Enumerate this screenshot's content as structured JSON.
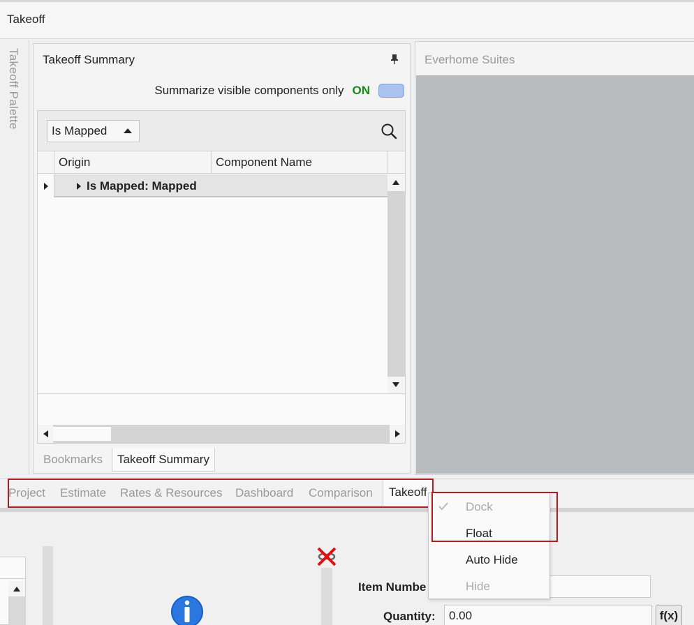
{
  "window": {
    "title": "Takeoff"
  },
  "palette": {
    "label": "Takeoff Palette"
  },
  "summary_panel": {
    "title": "Takeoff Summary",
    "summarize_label": "Summarize visible components only",
    "toggle_state": "ON",
    "filter_value": "Is Mapped",
    "columns": [
      "Origin",
      "Component Name"
    ],
    "group_row_label": "Is Mapped: Mapped",
    "tabs": [
      "Bookmarks",
      "Takeoff Summary"
    ],
    "active_tab": "Takeoff Summary"
  },
  "document": {
    "title": "Everhome Suites"
  },
  "bottom_tabs": {
    "items": [
      "Project",
      "Estimate",
      "Rates & Resources",
      "Dashboard",
      "Comparison",
      "Takeoff"
    ],
    "active": "Takeoff"
  },
  "context_menu": {
    "items": [
      {
        "label": "Dock",
        "checked": true,
        "disabled": true
      },
      {
        "label": "Float",
        "checked": false,
        "disabled": false
      },
      {
        "label": "Auto Hide",
        "checked": false,
        "disabled": false
      },
      {
        "label": "Hide",
        "checked": false,
        "disabled": true
      }
    ]
  },
  "form": {
    "item_number_label": "Item Numbe",
    "quantity_label": "Quantity:",
    "quantity_value": "0.00",
    "fx_label": "f(x)"
  },
  "colors": {
    "highlight": "#b51c1c",
    "toggle_on_text": "#1b8a1b",
    "toggle_fill": "#a8c4ee",
    "canvas": "#b9bcbf"
  },
  "icons": [
    "pin-icon",
    "search-icon",
    "check-icon",
    "unlink-icon",
    "info-icon"
  ]
}
